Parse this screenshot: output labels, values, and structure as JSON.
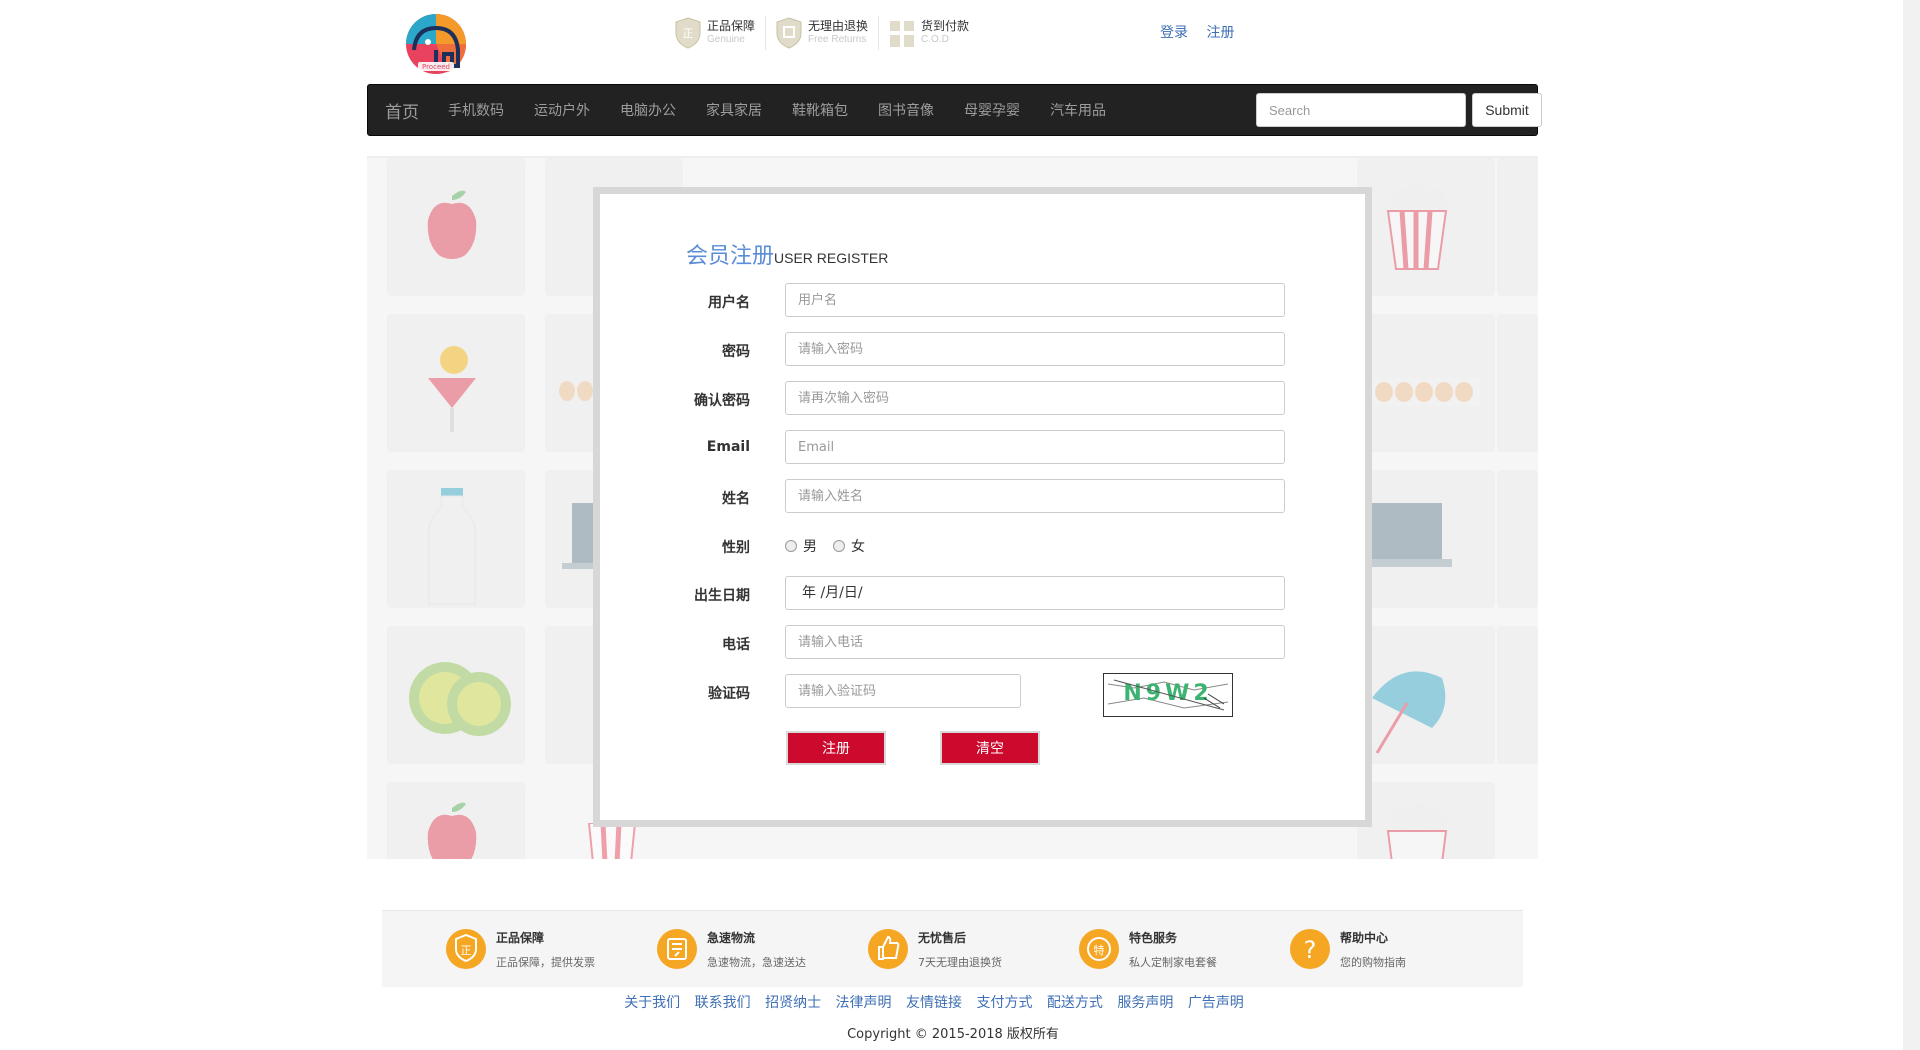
{
  "header": {
    "logo_text": "Proceed",
    "promises": [
      {
        "main": "正品保障",
        "sub": "Genuine"
      },
      {
        "main": "无理由退换",
        "sub": "Free Returns"
      },
      {
        "main": "货到付款",
        "sub": "C.O.D"
      }
    ],
    "auth": {
      "login": "登录",
      "register": "注册"
    }
  },
  "nav": {
    "items": [
      "首页",
      "手机数码",
      "运动户外",
      "电脑办公",
      "家具家居",
      "鞋靴箱包",
      "图书音像",
      "母婴孕婴",
      "汽车用品"
    ],
    "search_placeholder": "Search",
    "submit_label": "Submit"
  },
  "form": {
    "title_cn": "会员注册",
    "title_en": "USER REGISTER",
    "fields": {
      "username": {
        "label": "用户名",
        "placeholder": "用户名"
      },
      "password": {
        "label": "密码",
        "placeholder": "请输入密码"
      },
      "confirm": {
        "label": "确认密码",
        "placeholder": "请再次输入密码"
      },
      "email": {
        "label": "Email",
        "placeholder": "Email"
      },
      "name": {
        "label": "姓名",
        "placeholder": "请输入姓名"
      },
      "gender": {
        "label": "性别",
        "options": [
          "男",
          "女"
        ]
      },
      "birthday": {
        "label": "出生日期",
        "value": "年 /月/日/"
      },
      "phone": {
        "label": "电话",
        "placeholder": "请输入电话"
      },
      "captcha": {
        "label": "验证码",
        "placeholder": "请输入验证码",
        "image_text": "N9W2"
      }
    },
    "buttons": {
      "register": "注册",
      "clear": "清空"
    },
    "colors": {
      "title": "#5b8dd6",
      "button": "#cc0a2e"
    }
  },
  "services": [
    {
      "title": "正品保障",
      "desc": "正品保障，提供发票",
      "icon": "shield-icon"
    },
    {
      "title": "急速物流",
      "desc": "急速物流，急速送达",
      "icon": "truck-icon"
    },
    {
      "title": "无忧售后",
      "desc": "7天无理由退换货",
      "icon": "thumbs-up-icon"
    },
    {
      "title": "特色服务",
      "desc": "私人定制家电套餐",
      "icon": "special-icon"
    },
    {
      "title": "帮助中心",
      "desc": "您的购物指南",
      "icon": "help-icon"
    }
  ],
  "footer": {
    "links": [
      "关于我们",
      "联系我们",
      "招贤纳士",
      "法律声明",
      "友情链接",
      "支付方式",
      "配送方式",
      "服务声明",
      "广告声明"
    ],
    "copyright": "Copyright © 2015-2018 版权所有"
  }
}
